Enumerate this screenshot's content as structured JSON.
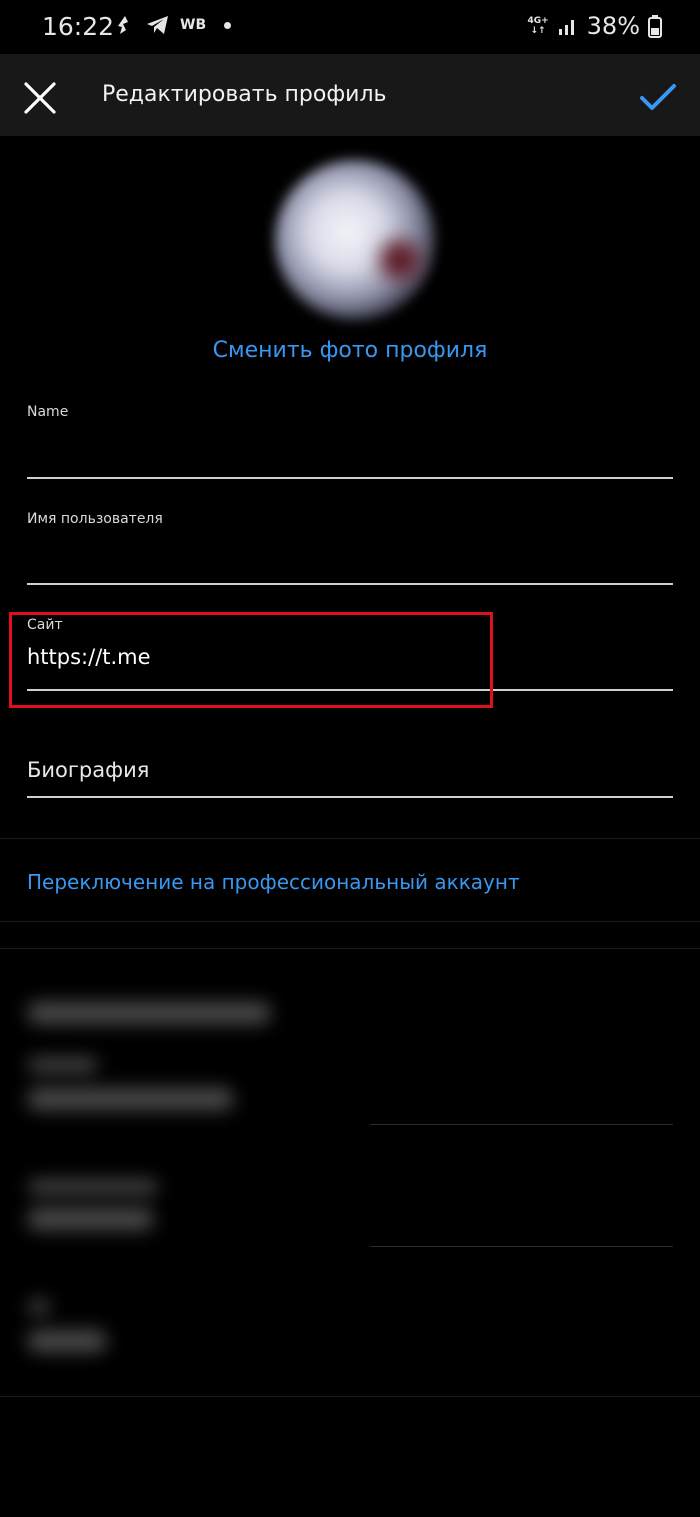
{
  "status_bar": {
    "time": "16:22",
    "carrier_badge": "WB",
    "network": "4G+",
    "battery": "38%"
  },
  "header": {
    "title": "Редактировать профиль"
  },
  "profile": {
    "change_photo_label": "Сменить фото профиля"
  },
  "fields": {
    "name_label": "Name",
    "name_value": "",
    "username_label": "Имя пользователя",
    "username_value": "",
    "site_label": "Сайт",
    "site_value": "https://t.me",
    "bio_placeholder": "Биография"
  },
  "links": {
    "professional_account": "Переключение на профессиональный аккаунт"
  },
  "colors": {
    "accent": "#3897f0",
    "highlight": "#e0101a",
    "background": "#000000",
    "header_bg": "#181818"
  }
}
